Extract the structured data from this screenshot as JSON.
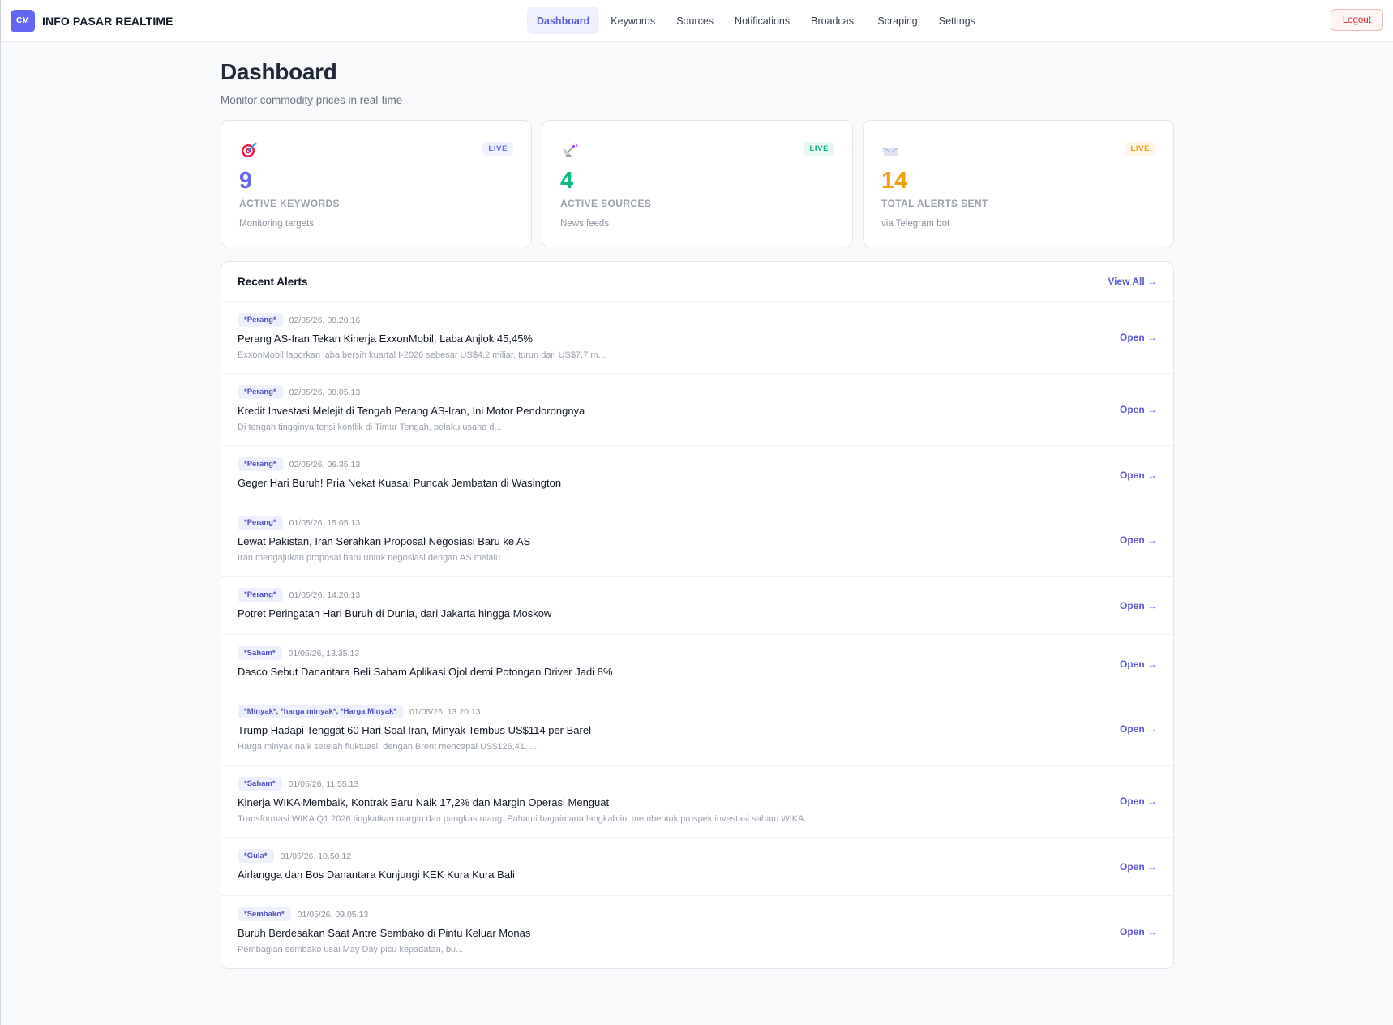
{
  "brand": {
    "logo": "CM",
    "name": "INFO PASAR REALTIME"
  },
  "nav": {
    "items": [
      {
        "label": "Dashboard",
        "active": true
      },
      {
        "label": "Keywords"
      },
      {
        "label": "Sources"
      },
      {
        "label": "Notifications"
      },
      {
        "label": "Broadcast"
      },
      {
        "label": "Scraping"
      },
      {
        "label": "Settings"
      }
    ],
    "logout": "Logout"
  },
  "page": {
    "title": "Dashboard",
    "subtitle": "Monitor commodity prices in real-time"
  },
  "stats": [
    {
      "icon": "target-icon",
      "badge": "LIVE",
      "value": "9",
      "label": "ACTIVE KEYWORDS",
      "desc": "Monitoring targets",
      "color": "#6366f1",
      "badge_bg": "#eef0fd"
    },
    {
      "icon": "satellite-dish-icon",
      "badge": "LIVE",
      "value": "4",
      "label": "ACTIVE SOURCES",
      "desc": "News feeds",
      "color": "#10b981",
      "badge_bg": "#e7f8f1"
    },
    {
      "icon": "envelope-icon",
      "badge": "LIVE",
      "value": "14",
      "label": "TOTAL ALERTS SENT",
      "desc": "via Telegram bot",
      "color": "#f59e0b",
      "badge_bg": "#fef5e6"
    }
  ],
  "alerts": {
    "title": "Recent Alerts",
    "view_all": "View All →",
    "open_label": "Open →",
    "items": [
      {
        "tag": "*Perang*",
        "time": "02/05/26, 08.20.16",
        "title": "Perang AS-Iran Tekan Kinerja ExxonMobil, Laba Anjlok 45,45%",
        "snippet": "ExxonMobil laporkan laba bersih kuartal I-2026 sebesar US$4,2 miliar, turun dari US$7,7 m..."
      },
      {
        "tag": "*Perang*",
        "time": "02/05/26, 08.05.13",
        "title": "Kredit Investasi Melejit di Tengah Perang AS-Iran, Ini Motor Pendorongnya",
        "snippet": "Di tengah tingginya tensi konflik di Timur Tengah, pelaku usaha d..."
      },
      {
        "tag": "*Perang*",
        "time": "02/05/26, 06.35.13",
        "title": "Geger Hari Buruh! Pria Nekat Kuasai Puncak Jembatan di Wasington",
        "snippet": ""
      },
      {
        "tag": "*Perang*",
        "time": "01/05/26, 15.05.13",
        "title": "Lewat Pakistan, Iran Serahkan Proposal Negosiasi Baru ke AS",
        "snippet": "Iran mengajukan proposal baru untuk negosiasi dengan AS melalu..."
      },
      {
        "tag": "*Perang*",
        "time": "01/05/26, 14.20.13",
        "title": "Potret Peringatan Hari Buruh di Dunia, dari Jakarta hingga Moskow",
        "snippet": ""
      },
      {
        "tag": "*Saham*",
        "time": "01/05/26, 13.35.13",
        "title": "Dasco Sebut Danantara Beli Saham Aplikasi Ojol demi Potongan Driver Jadi 8%",
        "snippet": ""
      },
      {
        "tag": "*Minyak*, *harga minyak*, *Harga Minyak*",
        "time": "01/05/26, 13.20.13",
        "title": "Trump Hadapi Tenggat 60 Hari Soal Iran, Minyak Tembus US$114 per Barel",
        "snippet": "Harga minyak naik setelah fluktuasi, dengan Brent mencapai US$126,41. ..."
      },
      {
        "tag": "*Saham*",
        "time": "01/05/26, 11.55.13",
        "title": "Kinerja WIKA Membaik, Kontrak Baru Naik 17,2% dan Margin Operasi Menguat",
        "snippet": "Transformasi WIKA Q1 2026 tingkatkan margin dan pangkas utang. Pahami bagaimana langkah ini membentuk prospek investasi saham WIKA."
      },
      {
        "tag": "*Gula*",
        "time": "01/05/26, 10.50.12",
        "title": "Airlangga dan Bos Danantara Kunjungi KEK Kura Kura Bali",
        "snippet": ""
      },
      {
        "tag": "*Sembako*",
        "time": "01/05/26, 09.05.13",
        "title": "Buruh Berdesakan Saat Antre Sembako di Pintu Keluar Monas",
        "snippet": "Pembagian sembako usai May Day picu kepadatan, bu..."
      }
    ]
  }
}
